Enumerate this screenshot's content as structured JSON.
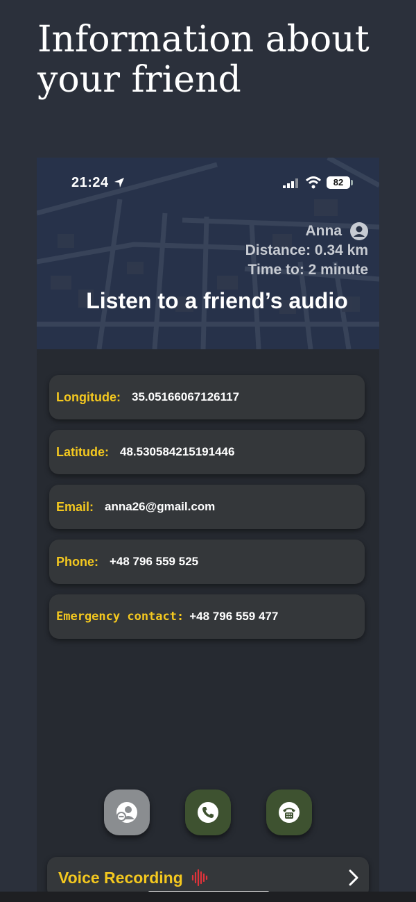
{
  "page": {
    "title": "Information about your friend"
  },
  "status_bar": {
    "time": "21:24",
    "battery": "82"
  },
  "friend": {
    "name": "Anna",
    "distance": "Distance: 0.34 km",
    "time_to": "Time to: 2 minute"
  },
  "header": {
    "title": "Listen to a friend’s audio"
  },
  "details": [
    {
      "label": "Longitude:",
      "value": "35.05166067126117"
    },
    {
      "label": "Latitude:",
      "value": "48.530584215191446"
    },
    {
      "label": "Email:",
      "value": "anna26@gmail.com"
    },
    {
      "label": "Phone:",
      "value": "+48 796 559 525"
    },
    {
      "label": "Emergency contact:",
      "value": "+48 796 559 477"
    }
  ],
  "voice": {
    "label": "Voice Recording"
  },
  "actions": {
    "remove_friend_icon": "person-minus-icon",
    "call_icon": "phone-icon",
    "emergency_call_icon": "telephone-circle-icon"
  },
  "colors": {
    "accent": "#f4c81f",
    "card_bg": "#34373a",
    "page_bg": "#2b303b",
    "audio_wave": "#e0333a",
    "action_green": "#3e5230",
    "action_gray": "#8a8d90"
  }
}
